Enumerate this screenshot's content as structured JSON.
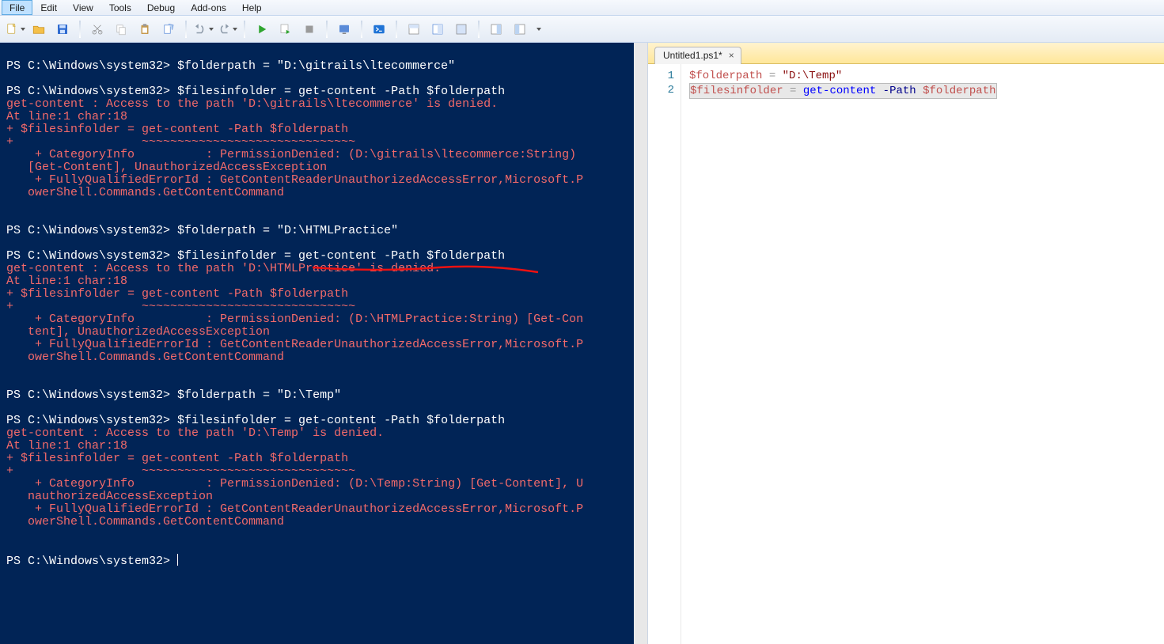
{
  "menu": {
    "file": "File",
    "edit": "Edit",
    "view": "View",
    "tools": "Tools",
    "debug": "Debug",
    "addons": "Add-ons",
    "help": "Help"
  },
  "console": {
    "blocks": [
      {
        "prompt1": "PS C:\\Windows\\system32> $folderpath = \"D:\\gitrails\\ltecommerce\"",
        "blank1": "",
        "prompt2": "PS C:\\Windows\\system32> $filesinfolder = get-content -Path $folderpath",
        "err1": "get-content : Access to the path 'D:\\gitrails\\ltecommerce' is denied.",
        "err2": "At line:1 char:18",
        "err3": "+ $filesinfolder = get-content -Path $folderpath",
        "err4": "+                  ~~~~~~~~~~~~~~~~~~~~~~~~~~~~~~",
        "err5": "    + CategoryInfo          : PermissionDenied: (D:\\gitrails\\ltecommerce:String)",
        "err6": "   [Get-Content], UnauthorizedAccessException",
        "err7": "    + FullyQualifiedErrorId : GetContentReaderUnauthorizedAccessError,Microsoft.P",
        "err8": "   owerShell.Commands.GetContentCommand"
      },
      {
        "prompt1": "PS C:\\Windows\\system32> $folderpath = \"D:\\HTMLPractice\"",
        "blank1": "",
        "prompt2": "PS C:\\Windows\\system32> $filesinfolder = get-content -Path $folderpath",
        "err1": "get-content : Access to the path 'D:\\HTMLPractice' is denied.",
        "err2": "At line:1 char:18",
        "err3": "+ $filesinfolder = get-content -Path $folderpath",
        "err4": "+                  ~~~~~~~~~~~~~~~~~~~~~~~~~~~~~~",
        "err5": "    + CategoryInfo          : PermissionDenied: (D:\\HTMLPractice:String) [Get-Con",
        "err6": "   tent], UnauthorizedAccessException",
        "err7": "    + FullyQualifiedErrorId : GetContentReaderUnauthorizedAccessError,Microsoft.P",
        "err8": "   owerShell.Commands.GetContentCommand"
      },
      {
        "prompt1": "PS C:\\Windows\\system32> $folderpath = \"D:\\Temp\"",
        "blank1": "",
        "prompt2": "PS C:\\Windows\\system32> $filesinfolder = get-content -Path $folderpath",
        "err1": "get-content : Access to the path 'D:\\Temp' is denied.",
        "err2": "At line:1 char:18",
        "err3": "+ $filesinfolder = get-content -Path $folderpath",
        "err4": "+                  ~~~~~~~~~~~~~~~~~~~~~~~~~~~~~~",
        "err5": "    + CategoryInfo          : PermissionDenied: (D:\\Temp:String) [Get-Content], U",
        "err6": "   nauthorizedAccessException",
        "err7": "    + FullyQualifiedErrorId : GetContentReaderUnauthorizedAccessError,Microsoft.P",
        "err8": "   owerShell.Commands.GetContentCommand"
      }
    ],
    "final_prompt": "PS C:\\Windows\\system32> "
  },
  "editor": {
    "tab_title": "Untitled1.ps1*",
    "close": "×",
    "ln1": "1",
    "ln2": "2",
    "line1": {
      "var": "$folderpath",
      "eq": " = ",
      "str": "\"D:\\Temp\""
    },
    "line2": {
      "var": "$filesinfolder",
      "eq": " = ",
      "cmd": "get-content",
      "sp": " ",
      "par": "-Path",
      "sp2": " ",
      "var2": "$folderpath"
    }
  }
}
